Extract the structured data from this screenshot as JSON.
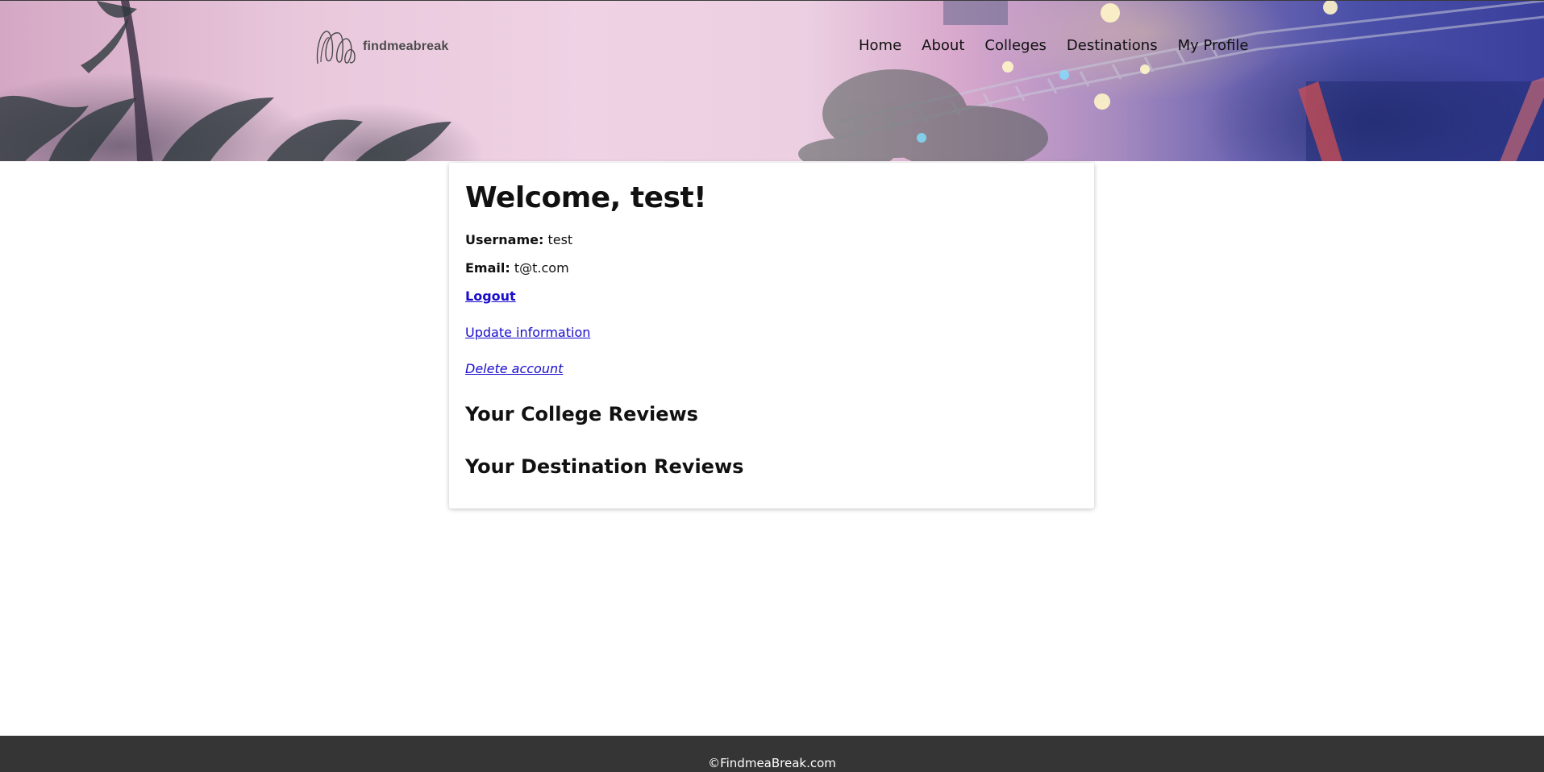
{
  "header": {
    "logo_text": "findmeabreak",
    "nav": [
      {
        "label": "Home"
      },
      {
        "label": "About"
      },
      {
        "label": "Colleges"
      },
      {
        "label": "Destinations"
      },
      {
        "label": "My Profile"
      }
    ]
  },
  "profile": {
    "welcome": "Welcome, test!",
    "username_label": "Username:",
    "username_value": "test",
    "email_label": "Email:",
    "email_value": "t@t.com",
    "logout": "Logout",
    "update": "Update information",
    "delete": "Delete account",
    "college_reviews_heading": "Your College Reviews",
    "destination_reviews_heading": "Your Destination Reviews"
  },
  "footer": {
    "copyright": "©FindmeaBreak.com"
  },
  "colors": {
    "link": "#1a0dcc",
    "footer_bg": "#353535",
    "text": "#111111"
  }
}
